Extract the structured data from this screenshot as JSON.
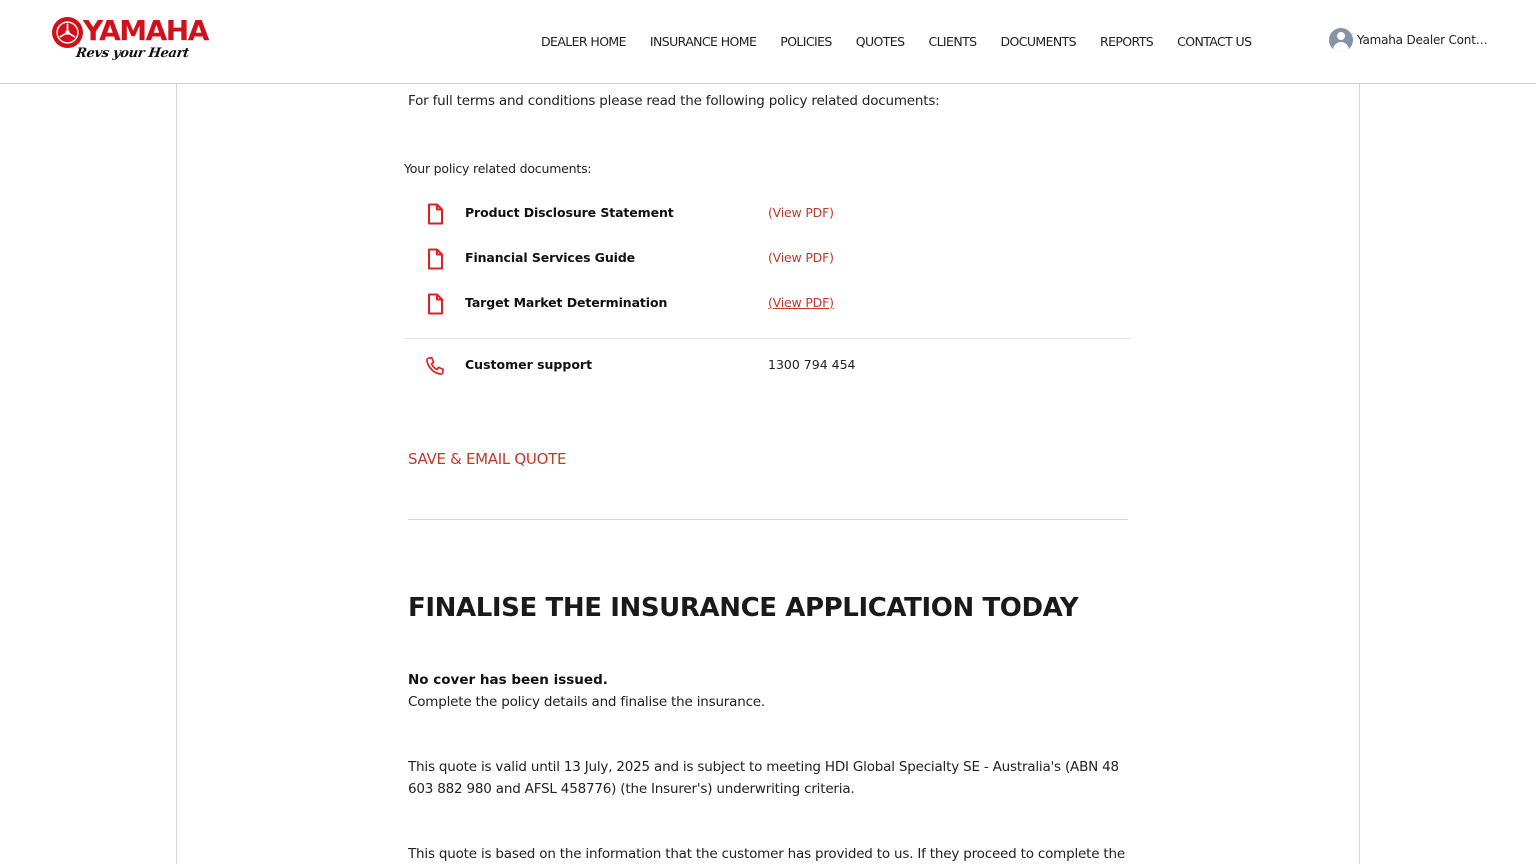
{
  "brand": {
    "name": "YAMAHA",
    "tagline": "Revs your Heart",
    "accent_color": "#d0101a"
  },
  "nav": {
    "items": [
      "DEALER HOME",
      "INSURANCE HOME",
      "POLICIES",
      "QUOTES",
      "CLIENTS",
      "DOCUMENTS",
      "REPORTS",
      "CONTACT US"
    ]
  },
  "user": {
    "name": "Yamaha Dealer Conta...",
    "icon": "user-avatar-icon"
  },
  "terms_text": "For full terms and conditions please read the following policy related documents:",
  "documents": {
    "title": "Your policy related documents:",
    "items": [
      {
        "label": "Product Disclosure Statement",
        "link": "(View PDF)",
        "icon": "document-icon"
      },
      {
        "label": "Financial Services Guide",
        "link": "(View PDF)",
        "icon": "document-icon"
      },
      {
        "label": "Target Market Determination",
        "link": "(View PDF)",
        "icon": "document-icon"
      }
    ]
  },
  "support": {
    "label": "Customer support",
    "phone": "1300 794 454",
    "icon": "phone-icon"
  },
  "save_button": "SAVE & EMAIL QUOTE",
  "finalise": {
    "heading": "FINALISE THE INSURANCE APPLICATION TODAY",
    "no_cover": "No cover has been issued.",
    "complete": "Complete the policy details and finalise the insurance.",
    "validity": "This quote is valid until 13 July, 2025 and is subject to meeting HDI Global Specialty SE - Australia's (ABN 48 603 882 980 and AFSL 458776) (the Insurer's) underwriting criteria.",
    "basis": "This quote is based on the information that the customer has provided to us. If they proceed to complete the"
  },
  "colors": {
    "link": "#c0392b",
    "icon_red": "#e02020"
  }
}
